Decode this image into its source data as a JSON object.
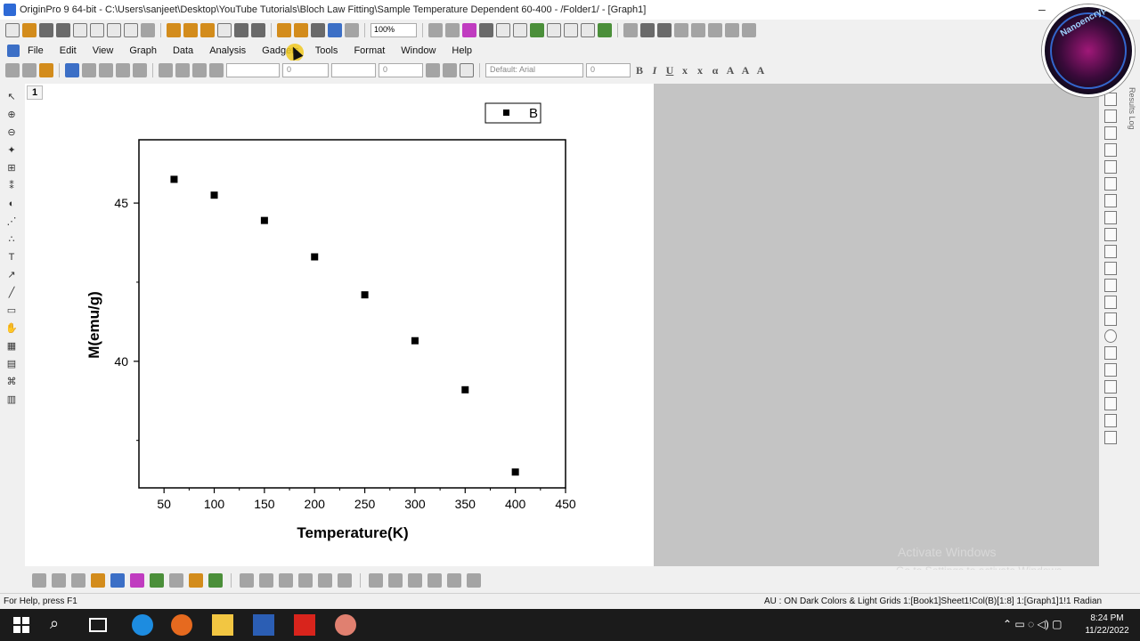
{
  "window": {
    "title": "OriginPro 9 64-bit - C:\\Users\\sanjeet\\Desktop\\YouTube Tutorials\\Bloch Law Fitting\\Sample Temperature Dependent 60-400 - /Folder1/ - [Graph1]"
  },
  "menu": {
    "items": [
      "File",
      "Edit",
      "View",
      "Graph",
      "Data",
      "Analysis",
      "Gadgets",
      "Tools",
      "Format",
      "Window",
      "Help"
    ]
  },
  "toolbar": {
    "zoom": "100%",
    "font": "Default: Arial",
    "font_size": "0",
    "line_width": "0",
    "border_width": "0"
  },
  "graph": {
    "layer_number": "1",
    "legend_label": "B",
    "xlabel": "Temperature(K)",
    "ylabel": "M(emu/g)",
    "xticks": [
      "50",
      "100",
      "150",
      "200",
      "250",
      "300",
      "350",
      "400",
      "450"
    ],
    "yticks": [
      "40",
      "45"
    ]
  },
  "chart_data": {
    "type": "scatter",
    "xlabel": "Temperature(K)",
    "ylabel": "M(emu/g)",
    "xlim": [
      25,
      450
    ],
    "ylim": [
      36,
      47
    ],
    "series": [
      {
        "name": "B",
        "x": [
          60,
          100,
          150,
          200,
          250,
          300,
          350,
          400
        ],
        "y": [
          45.75,
          45.25,
          44.45,
          43.3,
          42.1,
          40.65,
          39.1,
          36.5
        ]
      }
    ]
  },
  "side_panel": {
    "results_log": "Results Log"
  },
  "watermark": {
    "line1": "Activate Windows",
    "line2": "Go to Settings to activate Windows."
  },
  "status": {
    "left": "For Help, press F1",
    "right": "AU : ON  Dark Colors & Light Grids  1:[Book1]Sheet1!Col(B)[1:8]  1:[Graph1]1!1  Radian"
  },
  "taskbar": {
    "time": "8:24 PM",
    "date": "11/22/2022"
  },
  "logo": {
    "text": "Nanoencryptic"
  },
  "colors": {
    "accent": "#2e6ad6",
    "gray_pane": "#c4c4c4",
    "marker": "#000000"
  }
}
